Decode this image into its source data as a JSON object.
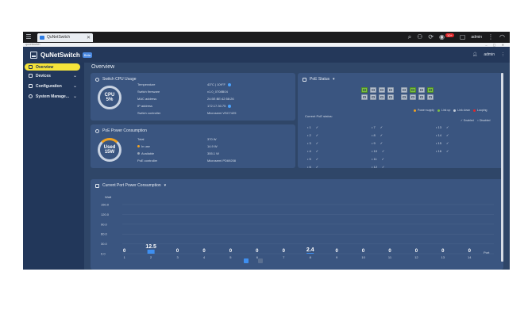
{
  "taskbar": {
    "tab_title": "QuNetSwitch",
    "user": "admin"
  },
  "address": {
    "text": "qunetswitch"
  },
  "app": {
    "brand": "QuNetSwitch",
    "badge": "Beta",
    "user": "admin"
  },
  "sidebar": {
    "items": [
      {
        "label": "Overview",
        "active": true,
        "icon": "dashboard-icon"
      },
      {
        "label": "Devices",
        "icon": "devices-icon",
        "chevron": true
      },
      {
        "label": "Configuration",
        "icon": "configuration-icon",
        "chevron": true
      },
      {
        "label": "System Manage...",
        "icon": "system-icon",
        "chevron": true
      }
    ]
  },
  "main": {
    "title": "Overview"
  },
  "cpu_card": {
    "title": "Switch CPU Usage",
    "gauge_label": "CPU",
    "gauge_value": "5%",
    "gauge_fraction": 0.05,
    "rows": [
      {
        "key": "Temperature",
        "value": "43°C | 109°F"
      },
      {
        "key": "Switch firmware",
        "value": "v1.0_0708B04"
      },
      {
        "key": "MAC address",
        "value": "24:5E:BE:42:58:26"
      },
      {
        "key": "IP address",
        "value": "172.17.30.75"
      },
      {
        "key": "Switch controller",
        "value": "Microsemi VSC7425"
      }
    ]
  },
  "poe_power_card": {
    "title": "PoE Power Consumption",
    "gauge_label": "Used",
    "gauge_value": "15W",
    "gauge_fraction": 0.05,
    "rows": [
      {
        "key": "Total",
        "value": "370 W"
      },
      {
        "key": "In use",
        "value": "14.9 W",
        "dot": "#f0a323"
      },
      {
        "key": "Available",
        "value": "355.1 W",
        "dot": "#9aa6b6"
      },
      {
        "key": "PoE controller",
        "value": "Microsemi PD69208"
      }
    ]
  },
  "poe_status_card": {
    "title": "PoE Status",
    "legend": [
      {
        "label": "Power supply",
        "color": "#f0a323"
      },
      {
        "label": "Link up",
        "color": "#7cc142"
      },
      {
        "label": "Link down",
        "color": "#c7cfda"
      },
      {
        "label": "Looping",
        "color": "#e0272b"
      }
    ],
    "current_label": "Current PoE status:",
    "enabled_label": "Enabled",
    "disabled_label": "Disabled",
    "ports": [
      {
        "port": "1",
        "status": "✓"
      },
      {
        "port": "2",
        "status": "✓"
      },
      {
        "port": "3",
        "status": "✓"
      },
      {
        "port": "4",
        "status": "✓"
      },
      {
        "port": "5",
        "status": "✓"
      },
      {
        "port": "6",
        "status": "✓"
      },
      {
        "port": "7",
        "status": "✓"
      },
      {
        "port": "8",
        "status": "✓"
      },
      {
        "port": "9",
        "status": "✓"
      },
      {
        "port": "10",
        "status": "✓"
      },
      {
        "port": "11",
        "status": "✓"
      },
      {
        "port": "12",
        "status": "✓"
      },
      {
        "port": "13",
        "status": "✓"
      },
      {
        "port": "14",
        "status": "✓"
      },
      {
        "port": "15",
        "status": "✓"
      },
      {
        "port": "16",
        "status": "✓"
      }
    ],
    "panel_top_green": [
      true,
      false,
      false,
      false,
      false,
      true,
      false,
      true
    ],
    "panel_bottom_green": [
      false,
      false,
      false,
      false,
      false,
      false,
      false,
      false
    ]
  },
  "chart_data": {
    "type": "bar",
    "title": "Current Port Power Consumption",
    "ylabel": "Watt",
    "xlabel": "Port",
    "ylim": [
      0,
      150
    ],
    "yticks": [
      "150.0",
      "120.0",
      "90.0",
      "60.0",
      "30.0",
      "0.0"
    ],
    "categories": [
      "1",
      "2",
      "3",
      "4",
      "5",
      "6",
      "7",
      "8",
      "9",
      "10",
      "11",
      "12",
      "13",
      "14"
    ],
    "values": [
      0,
      12.5,
      0,
      0,
      0,
      0,
      0,
      2.4,
      0,
      0,
      0,
      0,
      0,
      0
    ],
    "value_labels": [
      "0",
      "12.5",
      "0",
      "0",
      "0",
      "0",
      "0",
      "2.4",
      "0",
      "0",
      "0",
      "0",
      "0",
      "0"
    ],
    "bar_color": "#3e8ff0",
    "grid": true
  }
}
